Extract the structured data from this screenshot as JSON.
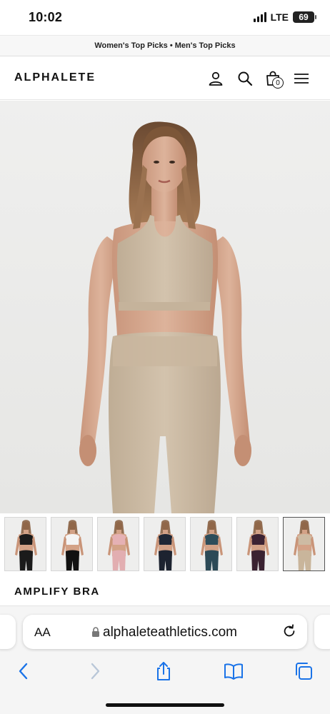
{
  "status_bar": {
    "time": "10:02",
    "network": "LTE",
    "battery": "69"
  },
  "promo": {
    "text": "Women's Top Picks • Men's Top Picks"
  },
  "header": {
    "logo": "ALPHALETE",
    "cart_count": "0",
    "icons": [
      "account-icon",
      "search-icon",
      "cart-icon",
      "menu-icon"
    ]
  },
  "gallery": {
    "thumbnails": [
      {
        "top": "#1b1b1b",
        "bottom": "#1b1b1b"
      },
      {
        "top": "#f4f4f4",
        "bottom": "#111111"
      },
      {
        "top": "#e5b1b4",
        "bottom": "#e2aeb1"
      },
      {
        "top": "#1f2735",
        "bottom": "#1d2330"
      },
      {
        "top": "#2e4d5a",
        "bottom": "#2c4a57"
      },
      {
        "top": "#3c2333",
        "bottom": "#3a2231"
      },
      {
        "top": "#cdbba3",
        "bottom": "#c9b59b"
      }
    ],
    "active_index": 6
  },
  "product": {
    "title": "AMPLIFY BRA"
  },
  "browser": {
    "aa_label": "AA",
    "url": "alphaleteathletics.com",
    "toolbar": [
      "back-icon",
      "forward-icon",
      "share-icon",
      "bookmarks-icon",
      "tabs-icon"
    ]
  },
  "colors": {
    "accent_blue": "#1a73e8",
    "product_beige": "#cdbba3",
    "background": "#ececeb"
  }
}
